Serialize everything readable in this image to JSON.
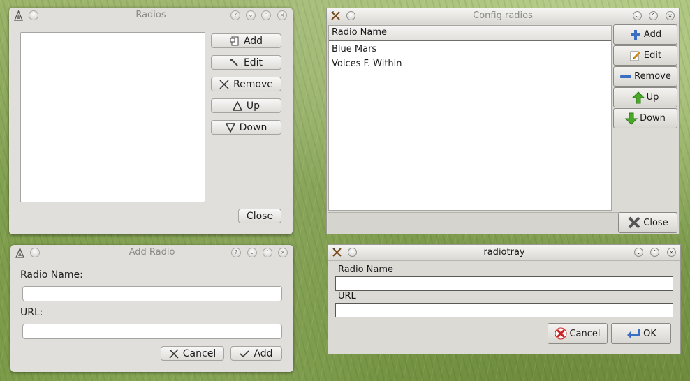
{
  "radios_window": {
    "title": "Radios",
    "add_label": "Add",
    "edit_label": "Edit",
    "remove_label": "Remove",
    "up_label": "Up",
    "down_label": "Down",
    "close_label": "Close"
  },
  "config_window": {
    "title": "Config radios",
    "column_header": "Radio Name",
    "stations": [
      "Blue Mars",
      "Voices F. Within"
    ],
    "add_label": "Add",
    "edit_label": "Edit",
    "remove_label": "Remove",
    "up_label": "Up",
    "down_label": "Down",
    "close_label": "Close"
  },
  "add_radio_window": {
    "title": "Add Radio",
    "name_label": "Radio Name:",
    "url_label": "URL:",
    "name_value": "",
    "url_value": "",
    "cancel_label": "Cancel",
    "add_label": "Add"
  },
  "radiotray_window": {
    "title": "radiotray",
    "name_label": "Radio Name",
    "url_label": "URL",
    "name_value": "",
    "url_value": "",
    "cancel_label": "Cancel",
    "ok_label": "OK"
  },
  "icons": {
    "kde_app": "kde-app-icon",
    "titlebar_buttons": [
      "help-icon",
      "minimize-icon",
      "maximize-icon",
      "close-icon"
    ]
  },
  "colors": {
    "kde_window": "#e0dfdb",
    "gtk_window": "#dcdad5",
    "cancel_red": "#cc2222",
    "add_blue": "#3a6fc4",
    "arrow_green": "#4aa82a"
  }
}
